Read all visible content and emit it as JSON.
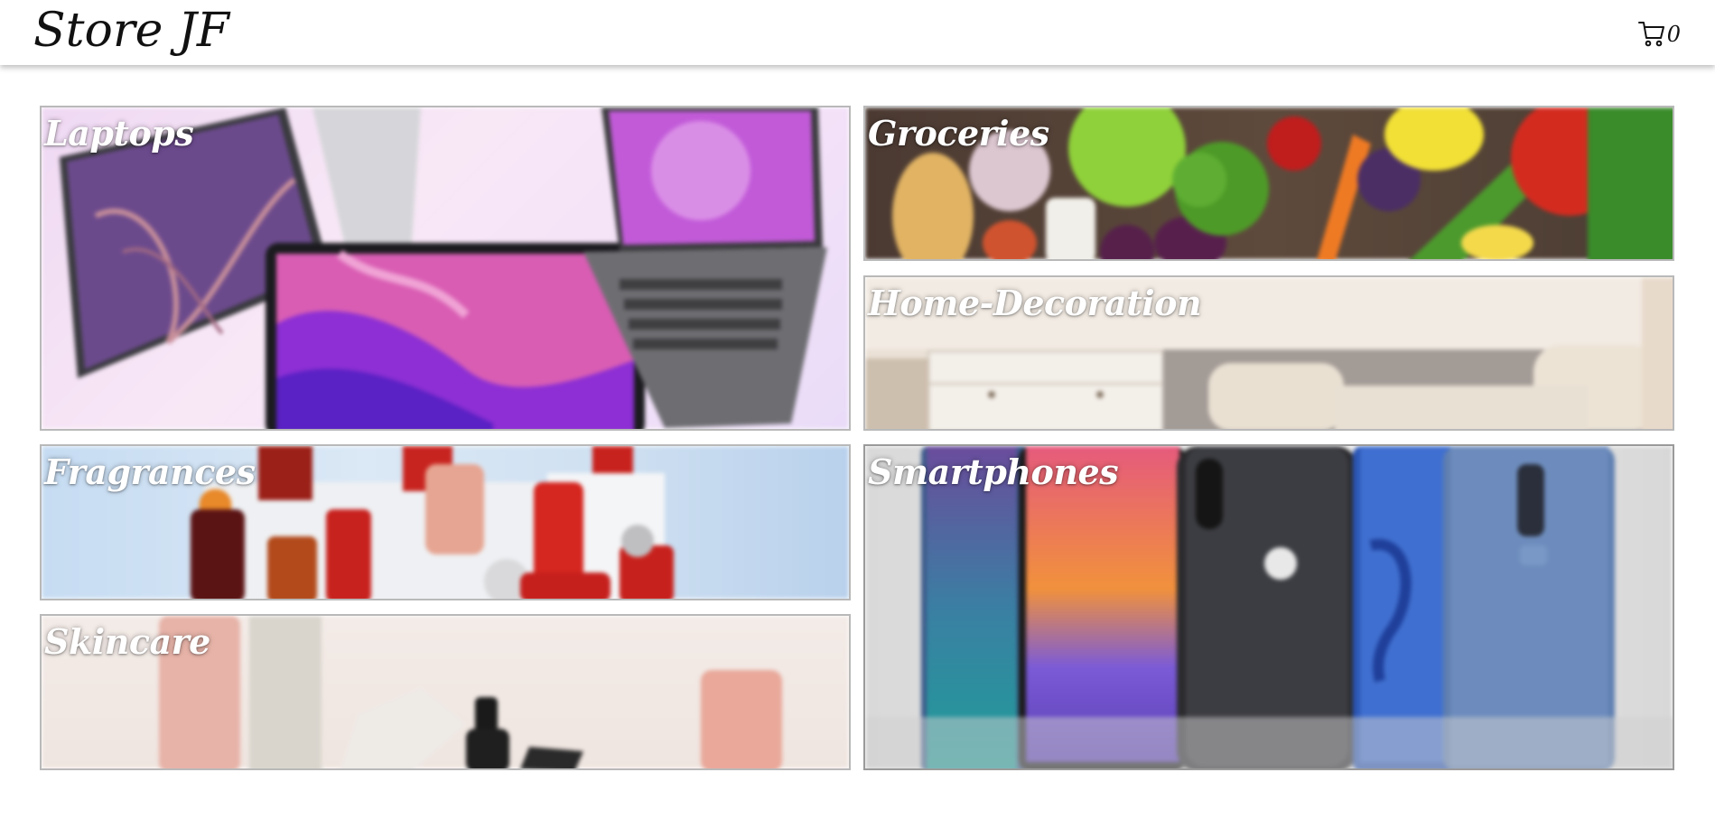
{
  "header": {
    "brand": "Store JF",
    "cart_count": "0",
    "cart_icon": "shopping-cart-icon"
  },
  "categories": [
    {
      "label": "Laptops"
    },
    {
      "label": "Groceries"
    },
    {
      "label": "Home-Decoration"
    },
    {
      "label": "Fragrances"
    },
    {
      "label": "Smartphones"
    },
    {
      "label": "Skincare"
    }
  ],
  "colors": {
    "header_bg": "#ffffff",
    "label_text": "#ffffff",
    "tile_border": "#b9b9b9"
  }
}
